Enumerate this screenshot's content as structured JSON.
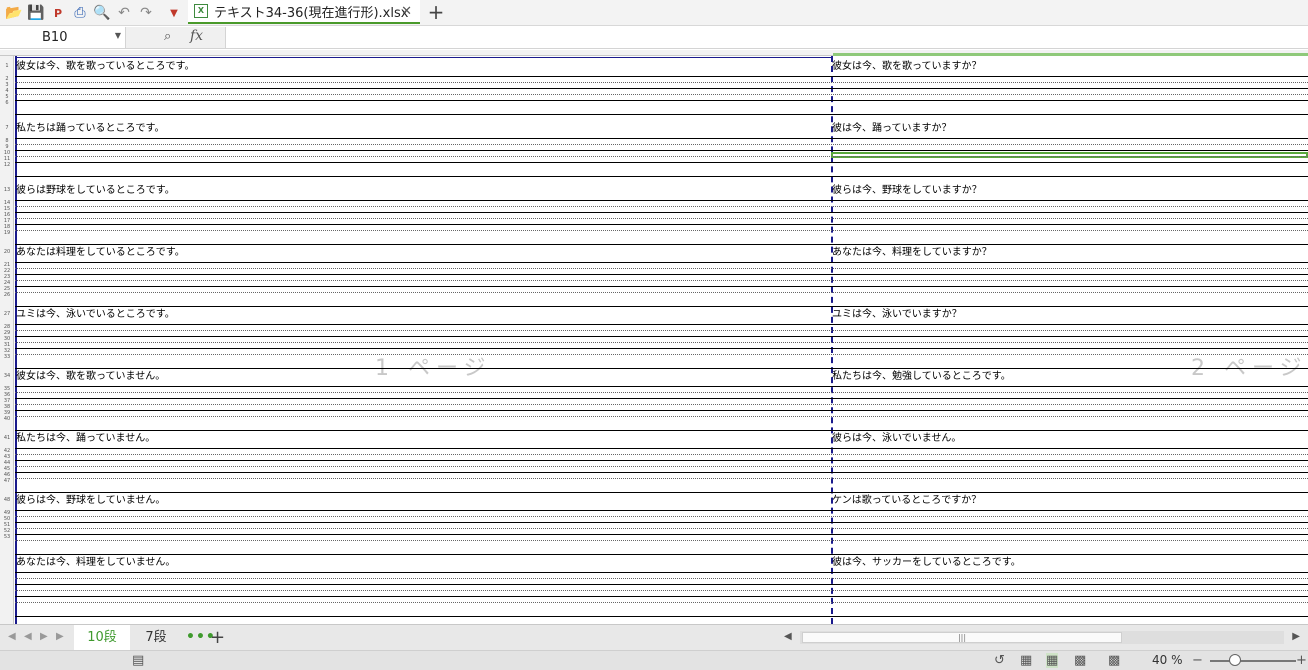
{
  "toolbar": {
    "icons": [
      "open-icon",
      "save-icon",
      "export-pdf-icon",
      "print-icon",
      "print-preview-icon",
      "undo-icon",
      "redo-icon",
      "customize-icon"
    ],
    "file_tab_label": "テキスト34-36(現在進行形).xlsx",
    "file_tab_close": "✕",
    "new_tab": "+"
  },
  "formula_bar": {
    "cell_reference": "B10",
    "formula_value": ""
  },
  "grid": {
    "row_numbers": [
      "1",
      "2",
      "3",
      "4",
      "5",
      "6",
      "7",
      "8",
      "9",
      "10",
      "11",
      "12",
      "13",
      "14",
      "15",
      "16",
      "17",
      "18",
      "19",
      "20",
      "21",
      "22",
      "23",
      "24",
      "25",
      "26",
      "27",
      "28",
      "29",
      "30",
      "31",
      "32",
      "33",
      "34",
      "35",
      "36",
      "37",
      "38",
      "39",
      "40",
      "41",
      "42",
      "43",
      "44",
      "45",
      "46",
      "47",
      "48",
      "49",
      "50",
      "51",
      "52",
      "53"
    ],
    "page_labels": [
      "1 ページ",
      "2 ページ"
    ],
    "left_column_cells": [
      "彼女は今、歌を歌っているところです。",
      "私たちは踊っているところです。",
      "彼らは野球をしているところです。",
      "あなたは料理をしているところです。",
      "ユミは今、泳いでいるところです。",
      "彼女は今、歌を歌っていません。",
      "私たちは今、踊っていません。",
      "彼らは今、野球をしていません。",
      "あなたは今、料理をしていません。"
    ],
    "right_column_cells": [
      "彼女は今、歌を歌っていますか？",
      "彼は今、踊っていますか？",
      "彼らは今、野球をしていますか？",
      "あなたは今、料理をしていますか？",
      "ユミは今、泳いでいますか？",
      "私たちは今、勉強しているところです。",
      "彼らは今、泳いでいません。",
      "ケンは歌っているところですか？",
      "彼は今、サッカーをしているところです。"
    ]
  },
  "sheet_tabs": {
    "tabs": [
      "10段",
      "7段"
    ],
    "active": "10段",
    "more": "•••",
    "add": "+"
  },
  "status_bar": {
    "zoom": "40 %",
    "zoom_minus": "−",
    "zoom_plus": "+"
  },
  "colors": {
    "accent": "#3f9a2e",
    "page_border": "#1a1a8c"
  }
}
